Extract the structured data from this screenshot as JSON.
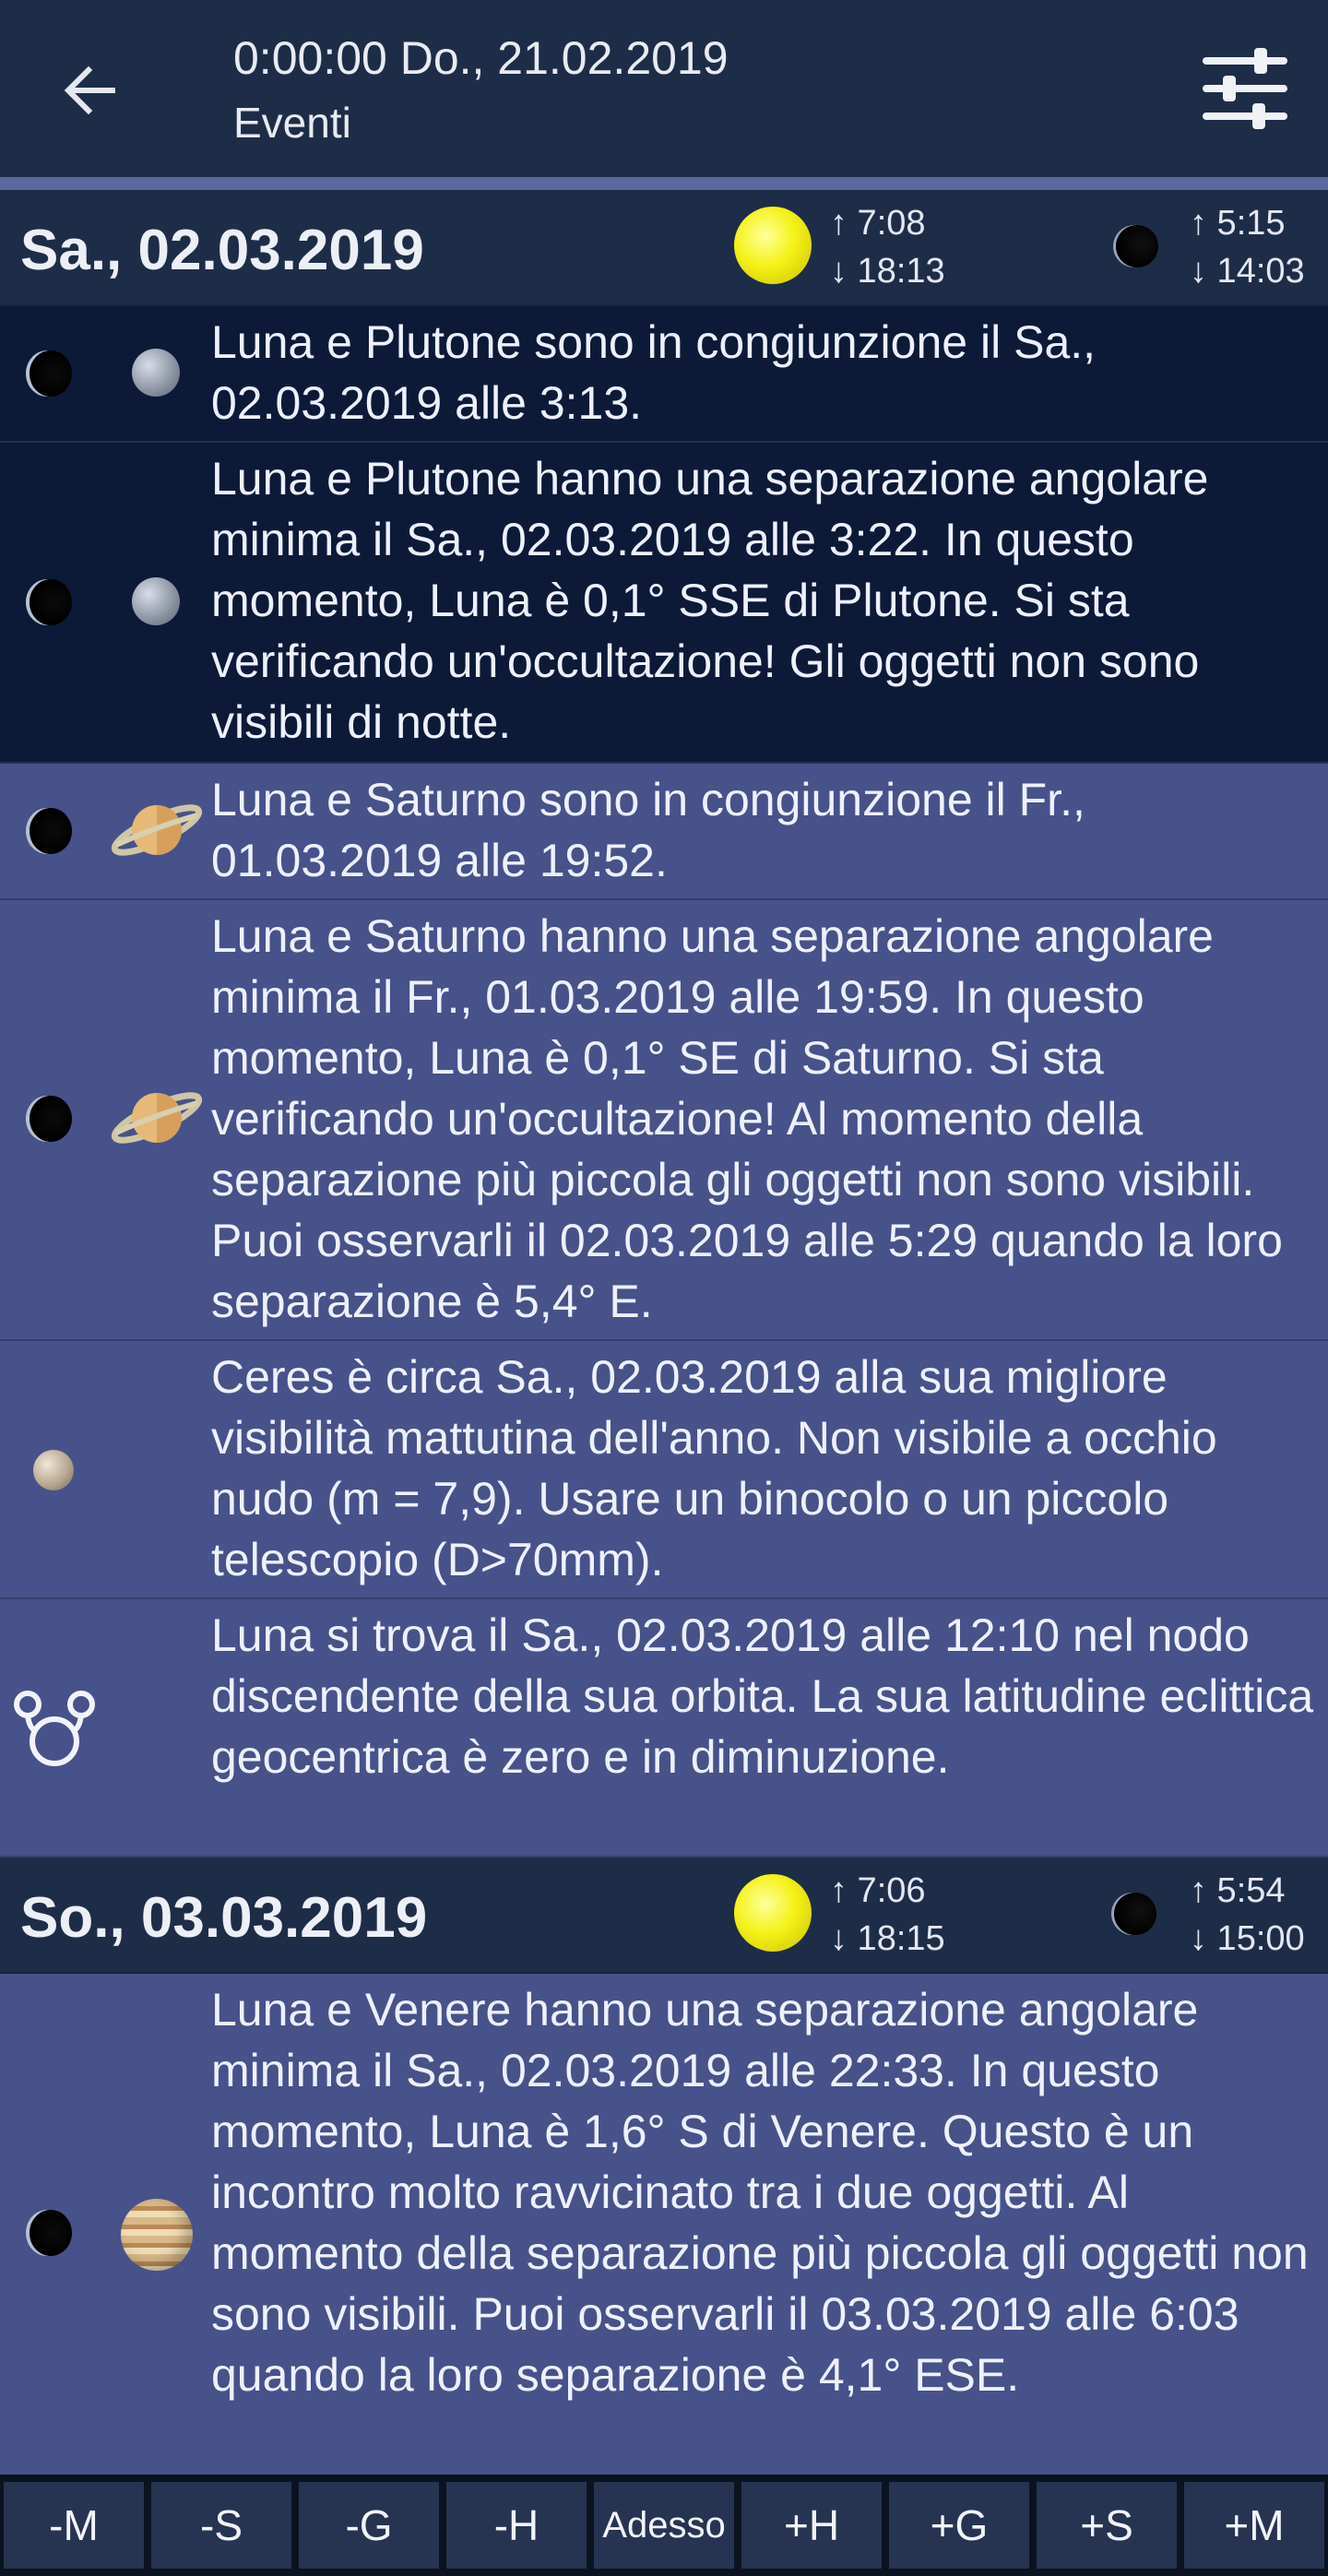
{
  "header": {
    "datetime": "0:00:00 Do., 21.02.2019",
    "subtitle": "Eventi",
    "back_icon": "arrow-left-icon",
    "filter_icon": "sliders-icon"
  },
  "days": [
    {
      "date": "Sa., 02.03.2019",
      "sun_rise": "↑ 7:08",
      "sun_set": "↓ 18:13",
      "moon_rise": "↑ 5:15",
      "moon_set": "↓ 14:03"
    },
    {
      "date": "So., 03.03.2019",
      "sun_rise": "↑ 7:06",
      "sun_set": "↓ 18:15",
      "moon_rise": "↑ 5:54",
      "moon_set": "↓ 15:00"
    }
  ],
  "events": [
    {
      "text": "Luna e Plutone sono in congiunzione il Sa., 02.03.2019 alle 3:13."
    },
    {
      "text": "Luna e Plutone hanno una separazione angolare minima il Sa., 02.03.2019 alle 3:22. In questo momento, Luna è 0,1° SSE di Plutone. Si sta verificando un'occultazione! Gli oggetti non sono visibili di notte."
    },
    {
      "text": "Luna e Saturno sono in congiunzione il Fr., 01.03.2019 alle 19:52."
    },
    {
      "text": "Luna e Saturno hanno una separazione angolare minima il Fr., 01.03.2019 alle 19:59. In questo momento, Luna è 0,1° SE di Saturno. Si sta verificando un'occultazione! Al momento della separazione più piccola gli oggetti non sono visibili. Puoi osservarli il 02.03.2019 alle 5:29 quando la loro separazione è 5,4° E."
    },
    {
      "text": "Ceres è circa Sa., 02.03.2019 alla sua migliore visibilità mattutina dell'anno. Non visibile a occhio nudo (m = 7,9). Usare un binocolo o un piccolo telescopio (D>70mm)."
    },
    {
      "text": "Luna si trova il Sa., 02.03.2019 alle 12:10 nel nodo discendente della sua orbita. La sua latitudine eclittica geocentrica è zero e in diminuzione."
    },
    {
      "text": "Luna e Venere hanno una separazione angolare minima il Sa., 02.03.2019 alle 22:33. In questo momento, Luna è 1,6° S di Venere. Questo è un incontro molto ravvicinato tra i due oggetti. Al momento della separazione più piccola gli oggetti non sono visibili. Puoi osservarli il 03.03.2019 alle 6:03 quando la loro separazione è 4,1° ESE."
    }
  ],
  "bottom_bar": [
    "-M",
    "-S",
    "-G",
    "-H",
    "Adesso",
    "+H",
    "+G",
    "+S",
    "+M"
  ],
  "colors": {
    "appbar": "#1e2d47",
    "list_bg": "#47528a",
    "highlight_bg": "#0c1a38",
    "sun": "#f4f217"
  }
}
